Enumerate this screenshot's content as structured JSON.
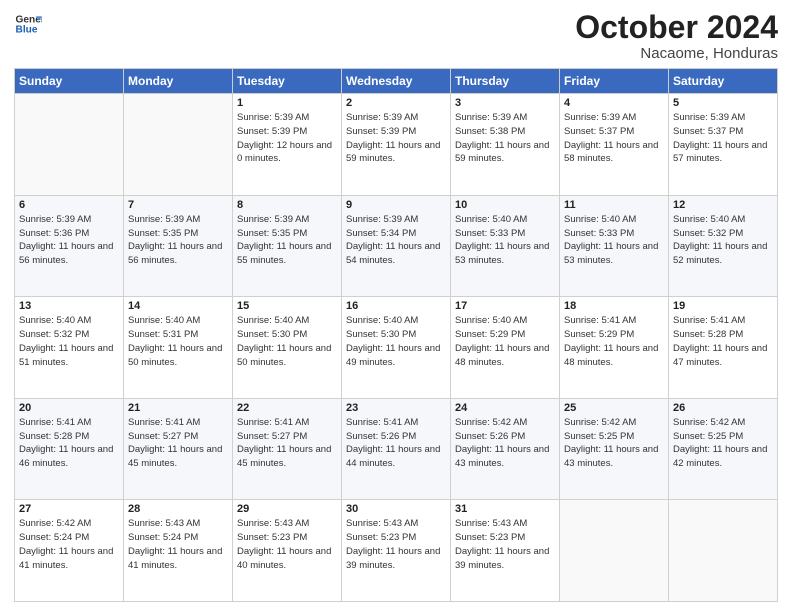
{
  "header": {
    "logo_line1": "General",
    "logo_line2": "Blue",
    "month": "October 2024",
    "location": "Nacaome, Honduras"
  },
  "weekdays": [
    "Sunday",
    "Monday",
    "Tuesday",
    "Wednesday",
    "Thursday",
    "Friday",
    "Saturday"
  ],
  "weeks": [
    [
      {
        "day": "",
        "info": ""
      },
      {
        "day": "",
        "info": ""
      },
      {
        "day": "1",
        "info": "Sunrise: 5:39 AM\nSunset: 5:39 PM\nDaylight: 12 hours and 0 minutes."
      },
      {
        "day": "2",
        "info": "Sunrise: 5:39 AM\nSunset: 5:39 PM\nDaylight: 11 hours and 59 minutes."
      },
      {
        "day": "3",
        "info": "Sunrise: 5:39 AM\nSunset: 5:38 PM\nDaylight: 11 hours and 59 minutes."
      },
      {
        "day": "4",
        "info": "Sunrise: 5:39 AM\nSunset: 5:37 PM\nDaylight: 11 hours and 58 minutes."
      },
      {
        "day": "5",
        "info": "Sunrise: 5:39 AM\nSunset: 5:37 PM\nDaylight: 11 hours and 57 minutes."
      }
    ],
    [
      {
        "day": "6",
        "info": "Sunrise: 5:39 AM\nSunset: 5:36 PM\nDaylight: 11 hours and 56 minutes."
      },
      {
        "day": "7",
        "info": "Sunrise: 5:39 AM\nSunset: 5:35 PM\nDaylight: 11 hours and 56 minutes."
      },
      {
        "day": "8",
        "info": "Sunrise: 5:39 AM\nSunset: 5:35 PM\nDaylight: 11 hours and 55 minutes."
      },
      {
        "day": "9",
        "info": "Sunrise: 5:39 AM\nSunset: 5:34 PM\nDaylight: 11 hours and 54 minutes."
      },
      {
        "day": "10",
        "info": "Sunrise: 5:40 AM\nSunset: 5:33 PM\nDaylight: 11 hours and 53 minutes."
      },
      {
        "day": "11",
        "info": "Sunrise: 5:40 AM\nSunset: 5:33 PM\nDaylight: 11 hours and 53 minutes."
      },
      {
        "day": "12",
        "info": "Sunrise: 5:40 AM\nSunset: 5:32 PM\nDaylight: 11 hours and 52 minutes."
      }
    ],
    [
      {
        "day": "13",
        "info": "Sunrise: 5:40 AM\nSunset: 5:32 PM\nDaylight: 11 hours and 51 minutes."
      },
      {
        "day": "14",
        "info": "Sunrise: 5:40 AM\nSunset: 5:31 PM\nDaylight: 11 hours and 50 minutes."
      },
      {
        "day": "15",
        "info": "Sunrise: 5:40 AM\nSunset: 5:30 PM\nDaylight: 11 hours and 50 minutes."
      },
      {
        "day": "16",
        "info": "Sunrise: 5:40 AM\nSunset: 5:30 PM\nDaylight: 11 hours and 49 minutes."
      },
      {
        "day": "17",
        "info": "Sunrise: 5:40 AM\nSunset: 5:29 PM\nDaylight: 11 hours and 48 minutes."
      },
      {
        "day": "18",
        "info": "Sunrise: 5:41 AM\nSunset: 5:29 PM\nDaylight: 11 hours and 48 minutes."
      },
      {
        "day": "19",
        "info": "Sunrise: 5:41 AM\nSunset: 5:28 PM\nDaylight: 11 hours and 47 minutes."
      }
    ],
    [
      {
        "day": "20",
        "info": "Sunrise: 5:41 AM\nSunset: 5:28 PM\nDaylight: 11 hours and 46 minutes."
      },
      {
        "day": "21",
        "info": "Sunrise: 5:41 AM\nSunset: 5:27 PM\nDaylight: 11 hours and 45 minutes."
      },
      {
        "day": "22",
        "info": "Sunrise: 5:41 AM\nSunset: 5:27 PM\nDaylight: 11 hours and 45 minutes."
      },
      {
        "day": "23",
        "info": "Sunrise: 5:41 AM\nSunset: 5:26 PM\nDaylight: 11 hours and 44 minutes."
      },
      {
        "day": "24",
        "info": "Sunrise: 5:42 AM\nSunset: 5:26 PM\nDaylight: 11 hours and 43 minutes."
      },
      {
        "day": "25",
        "info": "Sunrise: 5:42 AM\nSunset: 5:25 PM\nDaylight: 11 hours and 43 minutes."
      },
      {
        "day": "26",
        "info": "Sunrise: 5:42 AM\nSunset: 5:25 PM\nDaylight: 11 hours and 42 minutes."
      }
    ],
    [
      {
        "day": "27",
        "info": "Sunrise: 5:42 AM\nSunset: 5:24 PM\nDaylight: 11 hours and 41 minutes."
      },
      {
        "day": "28",
        "info": "Sunrise: 5:43 AM\nSunset: 5:24 PM\nDaylight: 11 hours and 41 minutes."
      },
      {
        "day": "29",
        "info": "Sunrise: 5:43 AM\nSunset: 5:23 PM\nDaylight: 11 hours and 40 minutes."
      },
      {
        "day": "30",
        "info": "Sunrise: 5:43 AM\nSunset: 5:23 PM\nDaylight: 11 hours and 39 minutes."
      },
      {
        "day": "31",
        "info": "Sunrise: 5:43 AM\nSunset: 5:23 PM\nDaylight: 11 hours and 39 minutes."
      },
      {
        "day": "",
        "info": ""
      },
      {
        "day": "",
        "info": ""
      }
    ]
  ]
}
